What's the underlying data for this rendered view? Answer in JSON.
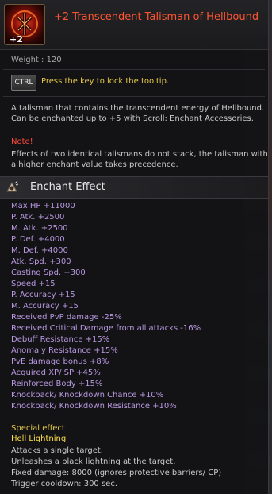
{
  "colors": {
    "title": "#ff5533",
    "stat": "#b898e0",
    "note": "#ff4a3a",
    "hint": "#e6c84a",
    "special_name": "#ffe24a",
    "background": "#141416"
  },
  "item": {
    "enchant_level": "+2",
    "name": "+2 Transcendent Talisman of Hellbound",
    "icon": "hellbound-talisman-icon"
  },
  "weight": "Weight : 120",
  "ctrl": {
    "key": "CTRL",
    "hint": "Press the key to lock the tooltip."
  },
  "description": "A talisman that contains the transcendent energy of Hellbound. Can be enchanted up to +5 with Scroll: Enchant Accessories.",
  "note": {
    "label": "Note!",
    "text": "Effects of two identical talismans do not stack, the talisman with a higher enchant value takes precedence."
  },
  "enchant_effect": {
    "title": "Enchant Effect",
    "icon": "enchant-effect-icon",
    "stats": [
      "Max HP +11000",
      "P. Atk. +2500",
      "M. Atk. +2500",
      "P. Def. +4000",
      "M. Def. +4000",
      "Atk. Spd. +300",
      "Casting Spd. +300",
      "Speed +15",
      "P. Accuracy +15",
      "M. Accuracy +15",
      "Received PvP damage -25%",
      "Received Critical Damage from all attacks -16%",
      "Debuff Resistance +15%",
      "Anomaly Resistance +15%",
      "PvE damage bonus +8%",
      "Acquired XP/ SP +45%",
      "Reinforced Body +15%",
      "Knockback/ Knockdown Chance +10%",
      "Knockback/ Knockdown Resistance +10%"
    ]
  },
  "special_effect": {
    "label": "Special effect",
    "name": "Hell Lightning",
    "lines": [
      "Attacks a single target.",
      "Unleashes a black lightning at the target.",
      "Fixed damage: 8000 (ignores protective barriers/ CP)",
      "Trigger cooldown: 300 sec."
    ]
  }
}
